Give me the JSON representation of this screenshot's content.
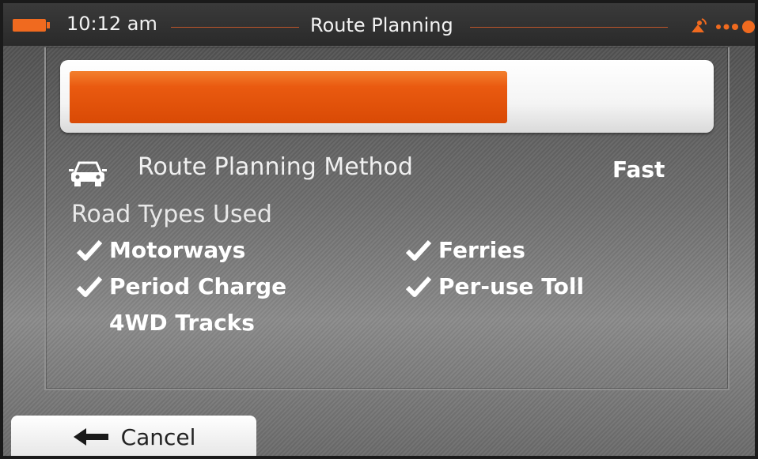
{
  "status_bar": {
    "time": "10:12 am",
    "title": "Route Planning"
  },
  "progress": {
    "fraction": 0.69
  },
  "route_method": {
    "label": "Route Planning Method",
    "value": "Fast",
    "icon": "car-icon"
  },
  "road_types": {
    "heading": "Road Types Used",
    "items": [
      {
        "label": "Motorways",
        "checked": true
      },
      {
        "label": "Ferries",
        "checked": true
      },
      {
        "label": "Period Charge",
        "checked": true
      },
      {
        "label": "Per-use Toll",
        "checked": true
      },
      {
        "label": "4WD Tracks",
        "checked": false
      }
    ]
  },
  "footer": {
    "cancel_label": "Cancel"
  },
  "colors": {
    "accent": "#ea5a10",
    "check": "#ffffff"
  }
}
